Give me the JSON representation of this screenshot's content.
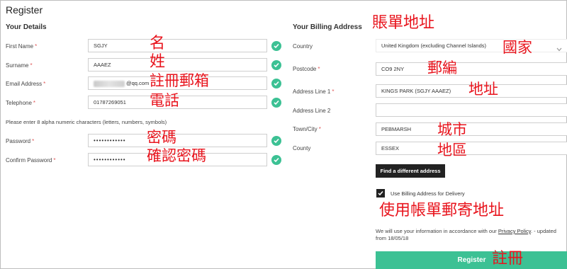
{
  "page": {
    "title": "Register"
  },
  "details": {
    "section_title": "Your Details",
    "first_name": {
      "label": "First Name",
      "value": "SGJY"
    },
    "surname": {
      "label": "Surname",
      "value": "AAAEZ"
    },
    "email": {
      "label": "Email Address",
      "value_suffix": "@qq.com"
    },
    "telephone": {
      "label": "Telephone",
      "value": "01787269051"
    },
    "password_hint": "Please enter 8 alpha numeric characters (letters, numbers, symbols)",
    "password": {
      "label": "Password",
      "value": "••••••••••••"
    },
    "confirm_password": {
      "label": "Confirm Password",
      "value": "••••••••••••"
    }
  },
  "billing": {
    "section_title": "Your Billing Address",
    "country": {
      "label": "Country",
      "value": "United Kingdom (excluding Channel Islands)"
    },
    "postcode": {
      "label": "Postcode",
      "value": "CO9 2NY"
    },
    "address1": {
      "label": "Address Line 1",
      "value": "KINGS PARK  (SGJY AAAEZ)"
    },
    "address2": {
      "label": "Address Line 2",
      "value": ""
    },
    "town": {
      "label": "Town/City",
      "value": "PEBMARSH"
    },
    "county": {
      "label": "County",
      "value": "ESSEX"
    },
    "find_button": "Find a different address",
    "use_for_delivery": "Use Billing Address for Delivery",
    "notice_prefix": "We will use your information in accordance with our",
    "notice_link": "Privacy Policy",
    "notice_suffix": ". - updated from 18/05/18",
    "register_button": "Register"
  },
  "annotations": {
    "first_name": "名",
    "surname": "姓",
    "email": "註冊郵箱",
    "telephone": "電話",
    "password": "密碼",
    "confirm_password": "確認密碼",
    "billing_address": "賬單地址",
    "country": "國家",
    "postcode": "郵編",
    "address": "地址",
    "city": "城市",
    "county": "地區",
    "use_billing": "使用帳單郵寄地址",
    "register": "註冊"
  },
  "colors": {
    "accent": "#3cc194",
    "annotation": "#e8141d",
    "dark_button": "#222222"
  }
}
